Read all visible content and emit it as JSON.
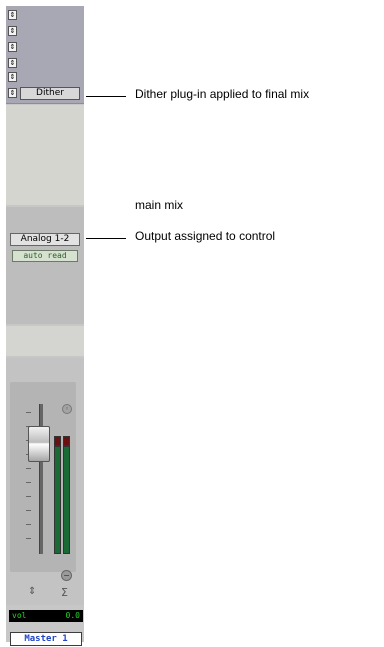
{
  "mix_strip": {
    "insert_slot_glyph": "⇕",
    "insert_plugin": "Dither",
    "output": "Analog 1-2",
    "automation_mode": "auto read",
    "volume_label": "vol",
    "volume_value": "0.0",
    "track_name": "Master 1",
    "pan_icon": "pan-knob-icon",
    "updown_icon": "⇕",
    "sigma_icon": "Σ",
    "meter_color": "#1a7a3a",
    "clip_color": "#7a1010",
    "name_color": "#1f45c8"
  },
  "annotations": {
    "dither": "Dither plug-in applied to final mix",
    "main_mix": "main mix",
    "output": "Output assigned to control"
  }
}
